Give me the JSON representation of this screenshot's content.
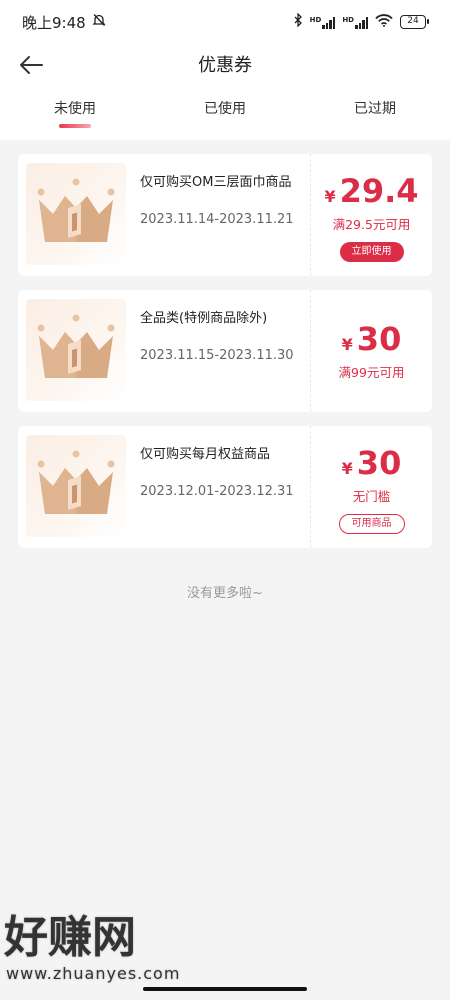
{
  "status_bar": {
    "time": "晚上9:48",
    "battery": "24",
    "hd1": "HD",
    "hd2": "HD"
  },
  "header": {
    "title": "优惠券"
  },
  "tabs": [
    {
      "label": "未使用",
      "active": true
    },
    {
      "label": "已使用",
      "active": false
    },
    {
      "label": "已过期",
      "active": false
    }
  ],
  "coupons": [
    {
      "name": "仅可购买OM三层面巾商品",
      "date": "2023.11.14-2023.11.21",
      "currency": "¥",
      "amount": "29.4",
      "condition": "满29.5元可用",
      "button": "立即使用"
    },
    {
      "name": "全品类(特例商品除外)",
      "date": "2023.11.15-2023.11.30",
      "currency": "¥",
      "amount": "30",
      "condition": "满99元可用"
    },
    {
      "name": "仅可购买每月权益商品",
      "date": "2023.12.01-2023.12.31",
      "currency": "¥",
      "amount": "30",
      "condition": "无门槛",
      "button": "可用商品"
    }
  ],
  "footer": {
    "no_more": "没有更多啦~"
  },
  "watermark": {
    "main": "好赚网",
    "url": "www.zhuanyes.com"
  },
  "colors": {
    "accent": "#dc2d47",
    "background": "#f4f4f4"
  }
}
